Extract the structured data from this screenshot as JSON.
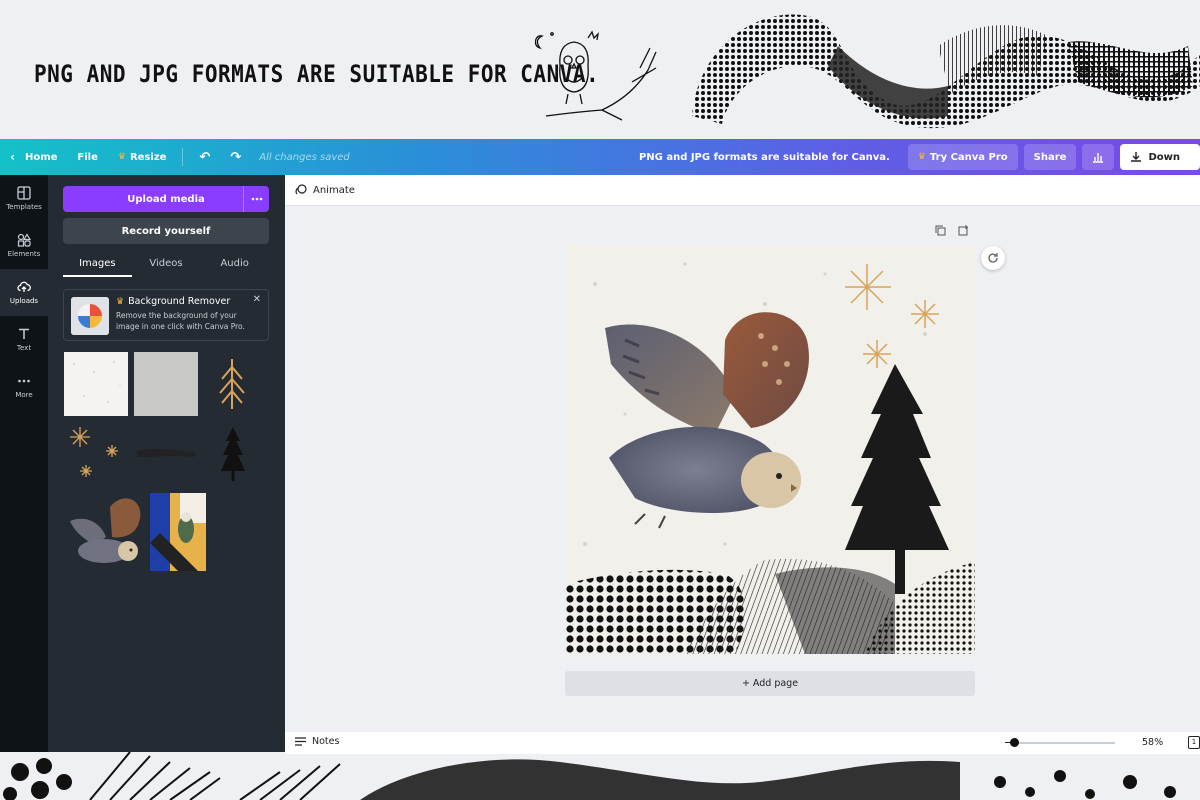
{
  "promo": {
    "title": "PNG AND JPG FORMATS ARE SUITABLE FOR CANVA."
  },
  "topbar": {
    "home": "Home",
    "file": "File",
    "resize": "Resize",
    "saved": "All changes saved",
    "message": "PNG and JPG formats are suitable for Canva.",
    "try_pro": "Try Canva Pro",
    "share": "Share",
    "download": "Down"
  },
  "rail": [
    {
      "label": "Templates",
      "icon": "templates-icon"
    },
    {
      "label": "Elements",
      "icon": "elements-icon"
    },
    {
      "label": "Uploads",
      "icon": "upload-cloud-icon",
      "active": true
    },
    {
      "label": "Text",
      "icon": "text-icon"
    },
    {
      "label": "More",
      "icon": "more-dots-icon"
    }
  ],
  "panel": {
    "upload_media": "Upload media",
    "record_yourself": "Record yourself",
    "tabs": [
      "Images",
      "Videos",
      "Audio"
    ],
    "active_tab": "Images",
    "bg_remover": {
      "title": "Background Remover",
      "desc": "Remove the background of your image in one click with Canva Pro."
    }
  },
  "editor": {
    "animate": "Animate",
    "add_page": "+ Add page"
  },
  "bottombar": {
    "notes": "Notes",
    "zoom": "58%",
    "page": "1"
  },
  "colors": {
    "accent": "#8b3dff",
    "panel": "#252b33",
    "rail": "#0e1318",
    "gold": "#d9a35a"
  }
}
